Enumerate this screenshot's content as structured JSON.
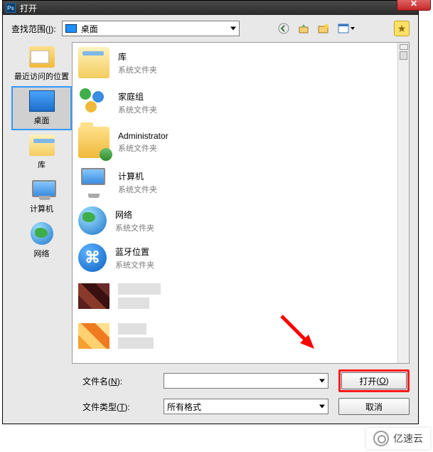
{
  "window": {
    "title": "打开"
  },
  "lookin": {
    "label_pre": "查找范围",
    "label_hot": "I",
    "label_post": ":",
    "value": "桌面"
  },
  "toolbar": {
    "back": "后退",
    "up": "向上",
    "newfolder": "新建文件夹",
    "viewmenu": "视图菜单",
    "favorite": "收藏"
  },
  "places": [
    {
      "id": "recent",
      "label": "最近访问的位置"
    },
    {
      "id": "desktop",
      "label": "桌面"
    },
    {
      "id": "library",
      "label": "库"
    },
    {
      "id": "computer",
      "label": "计算机"
    },
    {
      "id": "network",
      "label": "网络"
    }
  ],
  "files": [
    {
      "name": "库",
      "type": "系统文件夹",
      "icon": "lib"
    },
    {
      "name": "家庭组",
      "type": "系统文件夹",
      "icon": "homegrp"
    },
    {
      "name": "Administrator",
      "type": "系统文件夹",
      "icon": "userfolder"
    },
    {
      "name": "计算机",
      "type": "系统文件夹",
      "icon": "monitor"
    },
    {
      "name": "网络",
      "type": "系统文件夹",
      "icon": "globe"
    },
    {
      "name": "蓝牙位置",
      "type": "系统文件夹",
      "icon": "bt"
    }
  ],
  "fn": {
    "label_pre": "文件名",
    "label_hot": "N",
    "label_post": ":",
    "value": ""
  },
  "ft": {
    "label_pre": "文件类型",
    "label_hot": "T",
    "label_post": ":",
    "value": "所有格式"
  },
  "buttons": {
    "open_pre": "打开",
    "open_hot": "O",
    "cancel": "取消"
  },
  "watermark": "亿速云"
}
